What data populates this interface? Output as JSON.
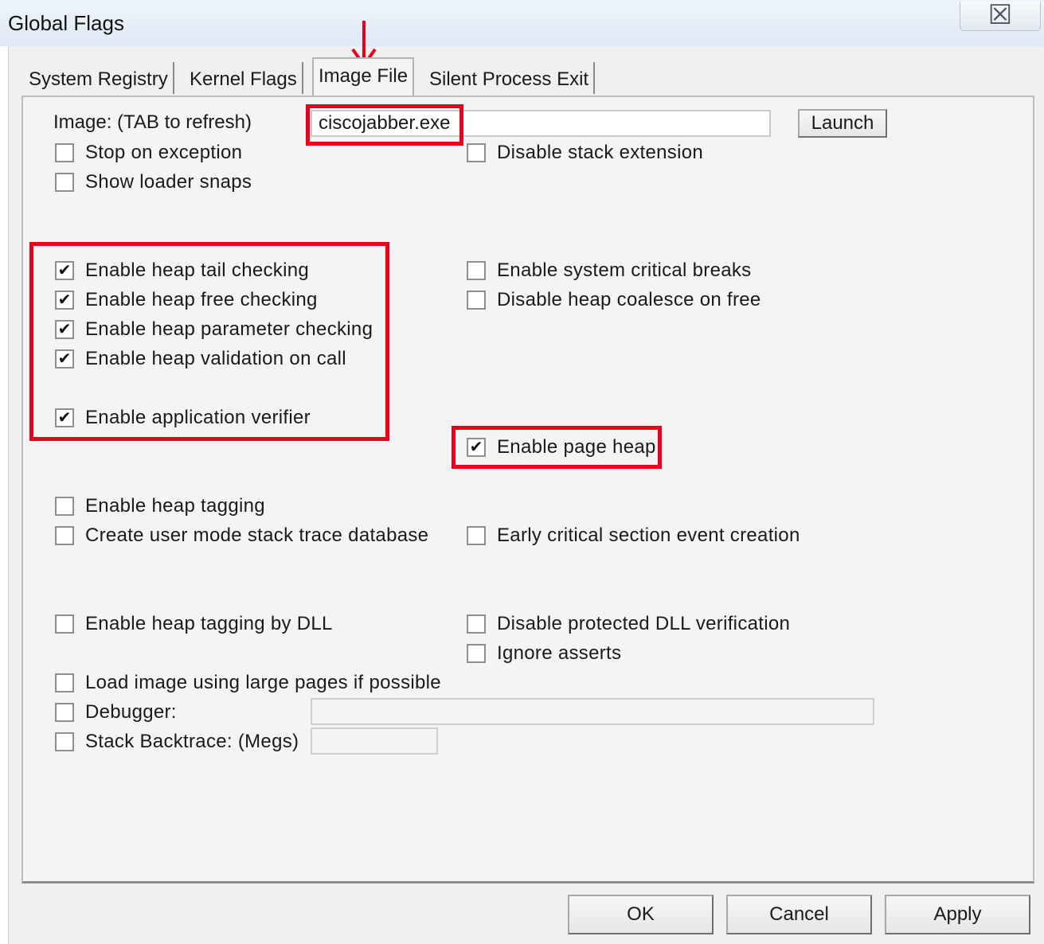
{
  "window": {
    "title": "Global Flags",
    "close_glyph": "☒"
  },
  "tabs": [
    {
      "label": "System Registry",
      "active": false
    },
    {
      "label": "Kernel Flags",
      "active": false
    },
    {
      "label": "Image File",
      "active": true
    },
    {
      "label": "Silent Process Exit",
      "active": false
    }
  ],
  "image": {
    "label": "Image: (TAB to refresh)",
    "value": "ciscojabber.exe",
    "launch_label": "Launch"
  },
  "checkboxes": {
    "stop_on_exception": {
      "label": "Stop on exception",
      "checked": false
    },
    "show_loader_snaps": {
      "label": "Show loader snaps",
      "checked": false
    },
    "disable_stack_extension": {
      "label": "Disable stack extension",
      "checked": false
    },
    "heap_tail_checking": {
      "label": "Enable heap tail checking",
      "checked": true
    },
    "heap_free_checking": {
      "label": "Enable heap free checking",
      "checked": true
    },
    "heap_parameter_checking": {
      "label": "Enable heap parameter checking",
      "checked": true
    },
    "heap_validation_on_call": {
      "label": "Enable heap validation on call",
      "checked": true
    },
    "application_verifier": {
      "label": "Enable application verifier",
      "checked": true
    },
    "system_critical_breaks": {
      "label": "Enable system critical breaks",
      "checked": false
    },
    "disable_heap_coalesce": {
      "label": "Disable heap coalesce on free",
      "checked": false
    },
    "page_heap": {
      "label": "Enable page heap",
      "checked": true
    },
    "heap_tagging": {
      "label": "Enable heap tagging",
      "checked": false
    },
    "user_mode_stack_trace": {
      "label": "Create user mode stack trace database",
      "checked": false
    },
    "early_critical_section": {
      "label": "Early critical section event creation",
      "checked": false
    },
    "heap_tagging_by_dll": {
      "label": "Enable heap tagging by DLL",
      "checked": false
    },
    "disable_protected_dll": {
      "label": "Disable protected DLL verification",
      "checked": false
    },
    "ignore_asserts": {
      "label": "Ignore asserts",
      "checked": false
    },
    "large_pages": {
      "label": "Load image using large pages if possible",
      "checked": false
    },
    "debugger": {
      "label": "Debugger:",
      "checked": false
    },
    "stack_backtrace": {
      "label": "Stack Backtrace: (Megs)",
      "checked": false
    }
  },
  "debugger_value": "",
  "stack_backtrace_value": "",
  "footer": {
    "ok": "OK",
    "cancel": "Cancel",
    "apply": "Apply"
  },
  "colors": {
    "highlight": "#e8001c",
    "dialog_bg": "#f0f0f0"
  }
}
